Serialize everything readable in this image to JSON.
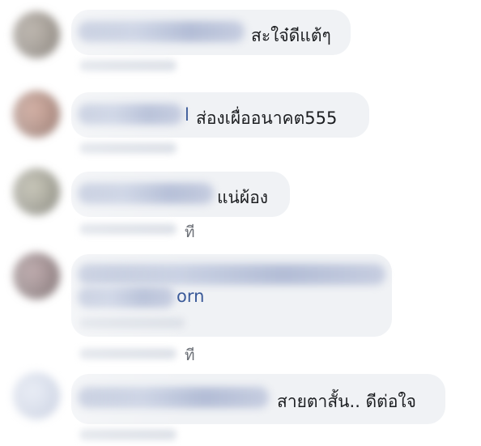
{
  "comments": [
    {
      "text": "สะใจ๋ดีแต้ๆ",
      "avatar_color": "#5b5248"
    },
    {
      "text_prefix": "l",
      "text": "ส่องเผื่ออนาคต555",
      "avatar_color": "#7a4a3d"
    },
    {
      "text": "แน่ผ้อง",
      "time": "ที",
      "avatar_color": "#6d6a5a"
    },
    {
      "text": "orn",
      "time": "ที",
      "avatar_color": "#5d4346"
    },
    {
      "text": "สายตาสั้น.. ดีต่อใจ",
      "avatar_color": "#c3cce0"
    }
  ],
  "colors": {
    "bubble": "#f0f2f5",
    "text": "#1c1e21",
    "link": "#385898"
  }
}
